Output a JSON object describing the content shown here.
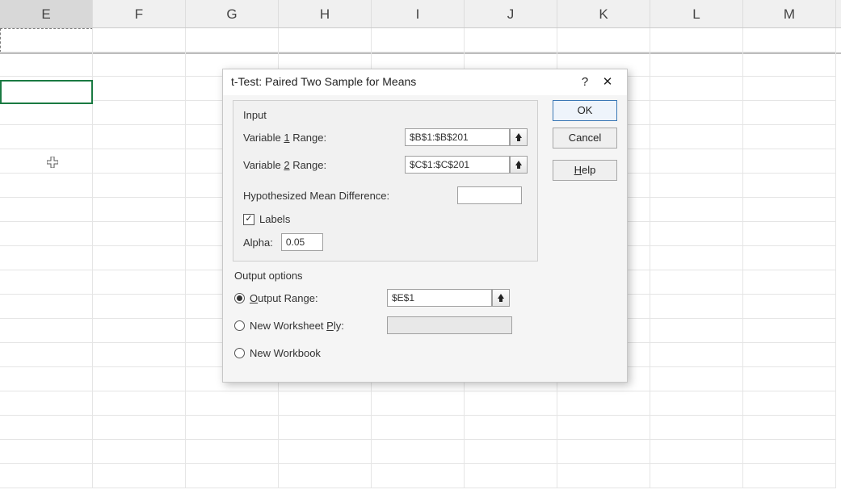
{
  "columns": [
    "E",
    "F",
    "G",
    "H",
    "I",
    "J",
    "K",
    "L",
    "M"
  ],
  "dialog": {
    "title": "t-Test: Paired Two Sample for Means",
    "help_icon": "?",
    "close_icon": "✕",
    "input_group": "Input",
    "var1_label_pre": "Variable ",
    "var1_label_ul": "1",
    "var1_label_post": " Range:",
    "var1_value": "$B$1:$B$201",
    "var2_label_pre": "Variable ",
    "var2_label_ul": "2",
    "var2_label_post": " Range:",
    "var2_value": "$C$1:$C$201",
    "hyp_label": "Hypothesized Mean Difference:",
    "hyp_value": "",
    "labels_checkbox_ul": "L",
    "labels_checkbox_rest": "abels",
    "labels_checked": true,
    "alpha_label_ul": "A",
    "alpha_label_rest": "lpha:",
    "alpha_value": "0.05",
    "output_group": "Output options",
    "output_range_ul": "O",
    "output_range_rest": "utput Range:",
    "output_range_value": "$E$1",
    "ply_pre": "New Worksheet ",
    "ply_ul": "P",
    "ply_post": "ly:",
    "ply_value": "",
    "workbook_pre": "New ",
    "workbook_ul": "W",
    "workbook_post": "orkbook",
    "buttons": {
      "ok": "OK",
      "cancel": "Cancel",
      "help_ul": "H",
      "help_rest": "elp"
    }
  }
}
